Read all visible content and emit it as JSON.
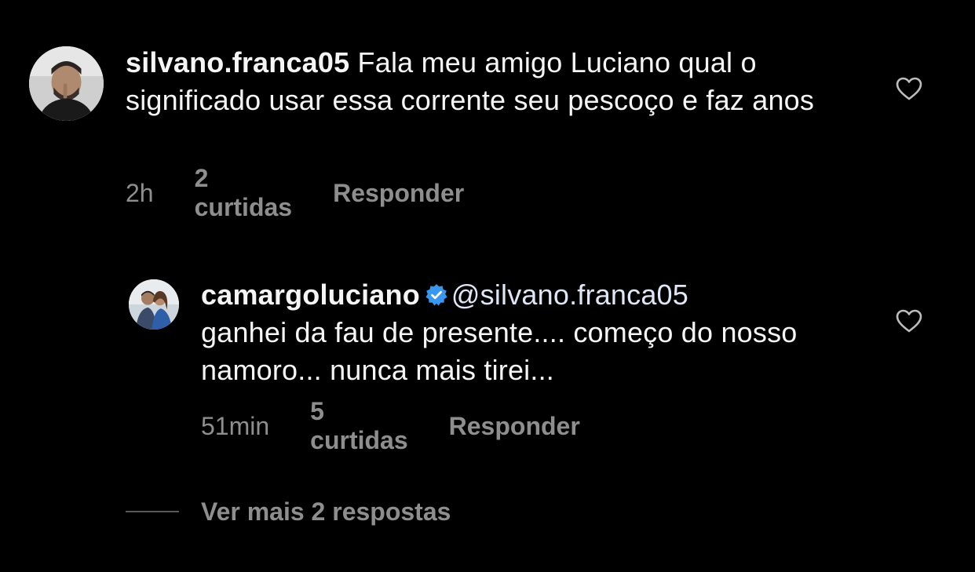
{
  "comment": {
    "username": "silvano.franca05",
    "text": " Fala meu amigo Luciano qual o significado usar essa corrente seu pescoço e faz anos",
    "time": "2h",
    "likes": "2 curtidas",
    "reply_label": "Responder",
    "avatar_icon": "user-avatar-photo",
    "heart_icon": "heart-outline-icon"
  },
  "reply": {
    "username": "camargoluciano",
    "verified_icon": "verified-badge-icon",
    "verified_color": "#3897f0",
    "mention": "@silvano.franca05",
    "text": "ganhei da fau de presente.... começo do nosso namoro... nunca mais tirei...",
    "time": "51min",
    "likes": "5 curtidas",
    "reply_label": "Responder",
    "avatar_icon": "user-avatar-photo",
    "heart_icon": "heart-outline-icon"
  },
  "more_replies": {
    "label": "Ver mais 2 respostas"
  },
  "colors": {
    "background": "#000000",
    "text_primary": "#f5f5f5",
    "text_secondary": "#8e8e8e"
  }
}
